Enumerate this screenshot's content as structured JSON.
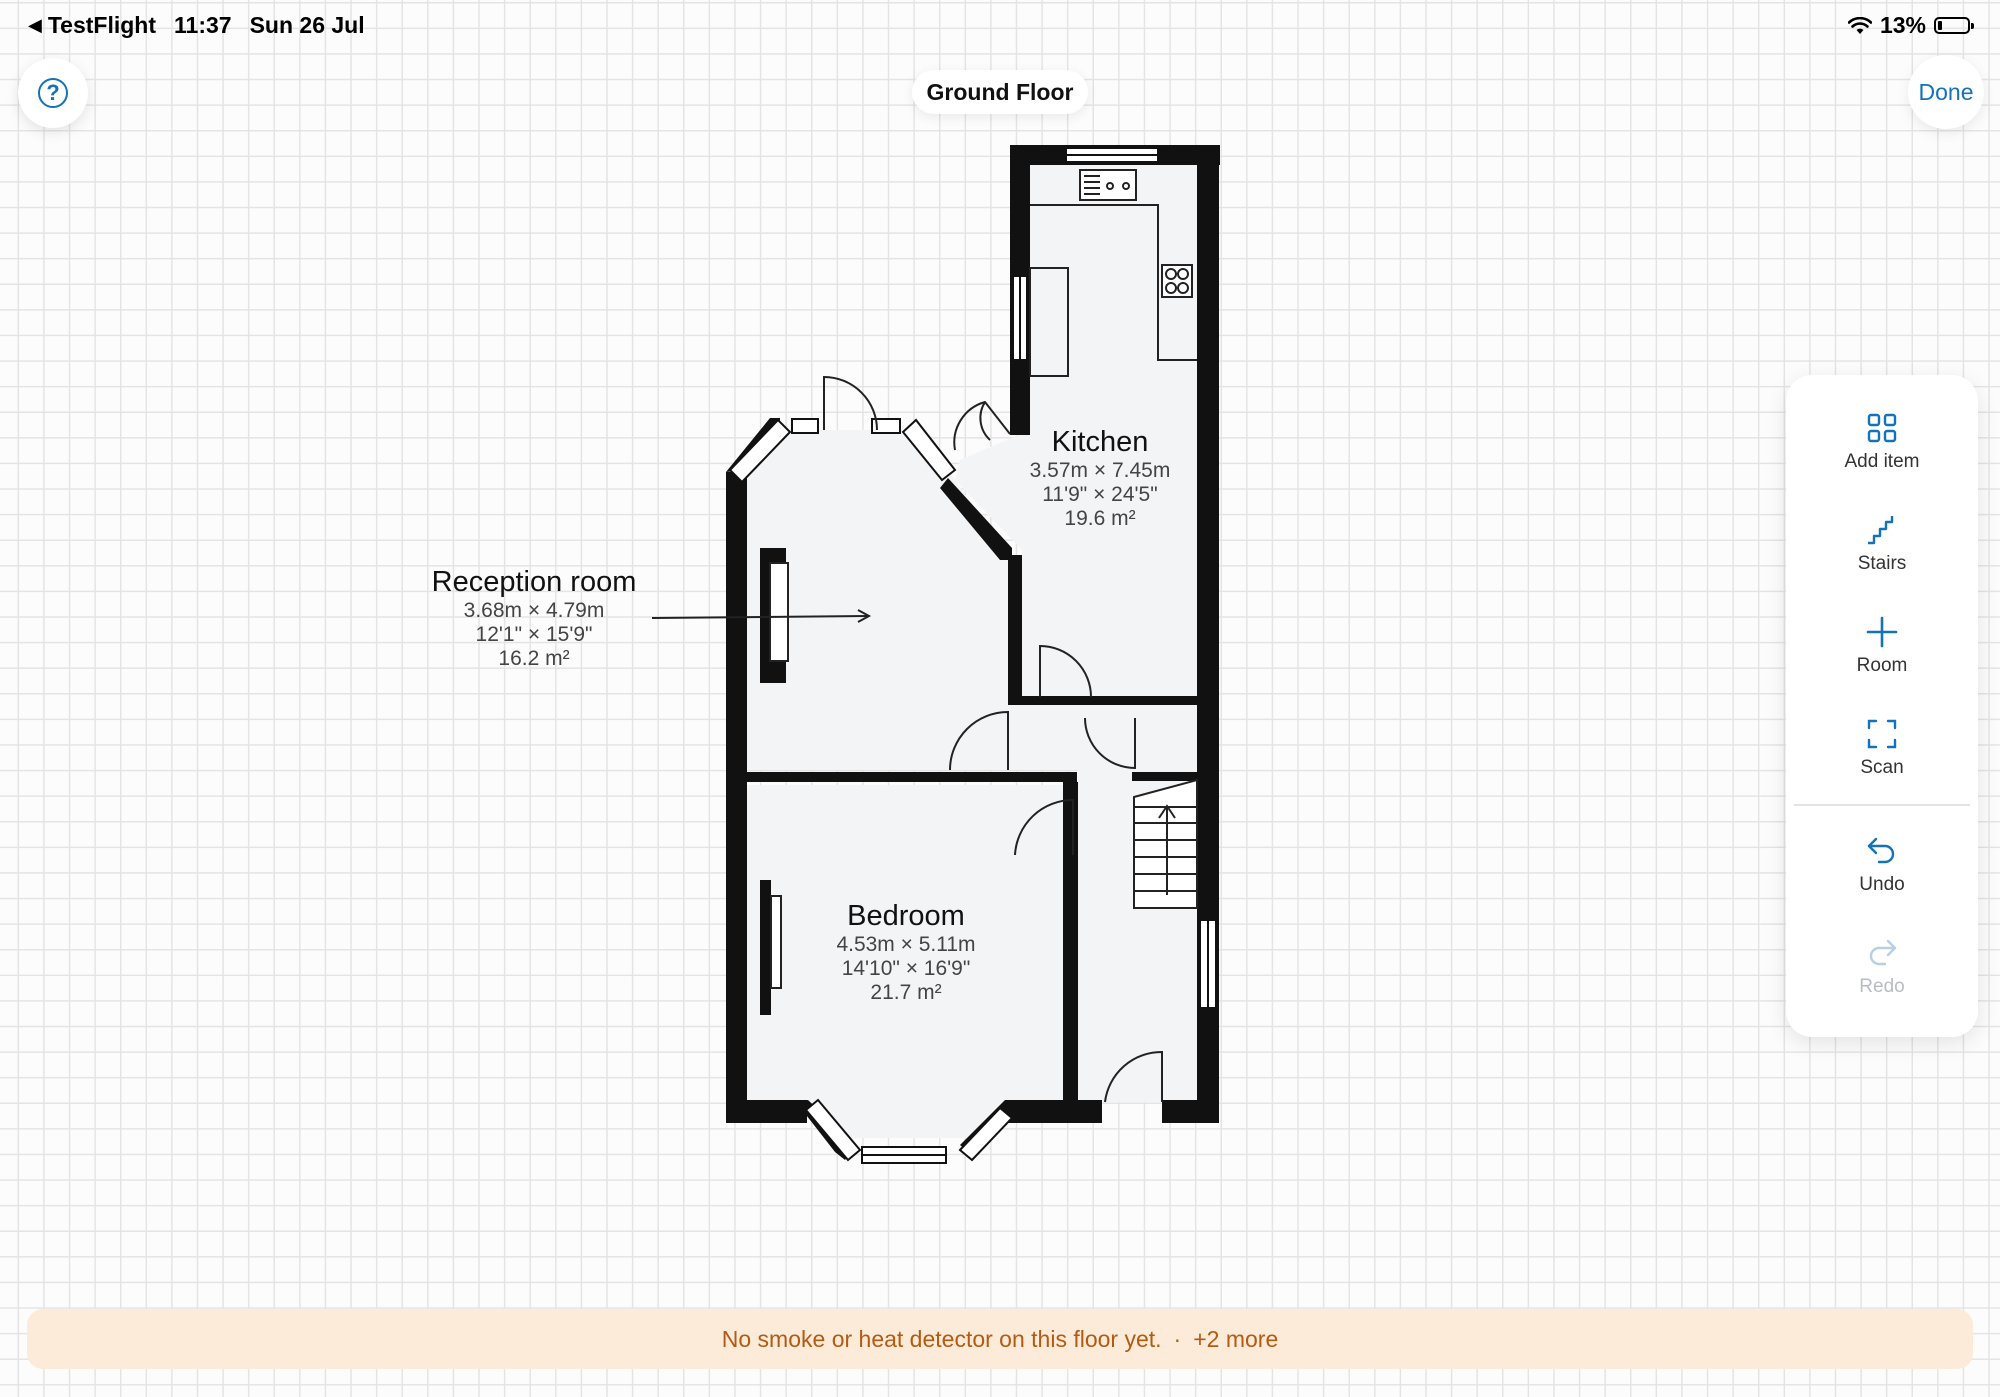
{
  "status_bar": {
    "back_app": "TestFlight",
    "time": "11:37",
    "date": "Sun 26 Jul",
    "battery": "13%"
  },
  "header": {
    "help_label": "?",
    "title": "Ground Floor",
    "done_label": "Done"
  },
  "rooms": {
    "reception": {
      "name": "Reception room",
      "metric": "3.68m × 4.79m",
      "imperial": "12'1\" × 15'9\"",
      "area": "16.2 m²"
    },
    "kitchen": {
      "name": "Kitchen",
      "metric": "3.57m × 7.45m",
      "imperial": "11'9\" × 24'5\"",
      "area": "19.6 m²"
    },
    "bedroom": {
      "name": "Bedroom",
      "metric": "4.53m × 5.11m",
      "imperial": "14'10\" × 16'9\"",
      "area": "21.7 m²"
    }
  },
  "toolbar": {
    "items": [
      {
        "label": "Add item",
        "icon": "grid-icon",
        "enabled": true
      },
      {
        "label": "Stairs",
        "icon": "stairs-icon",
        "enabled": true
      },
      {
        "label": "Room",
        "icon": "plus-icon",
        "enabled": true
      },
      {
        "label": "Scan",
        "icon": "scan-icon",
        "enabled": true
      },
      {
        "label": "Undo",
        "icon": "undo-icon",
        "enabled": true
      },
      {
        "label": "Redo",
        "icon": "redo-icon",
        "enabled": false
      }
    ]
  },
  "banner": {
    "message": "No smoke or heat detector on this floor yet.",
    "separator": "·",
    "more": "+2 more"
  },
  "colors": {
    "accent": "#1473b8",
    "wall": "#111111",
    "room_fill": "#f3f4f6",
    "banner_bg": "#fbebd8",
    "banner_text": "#b55a12"
  }
}
